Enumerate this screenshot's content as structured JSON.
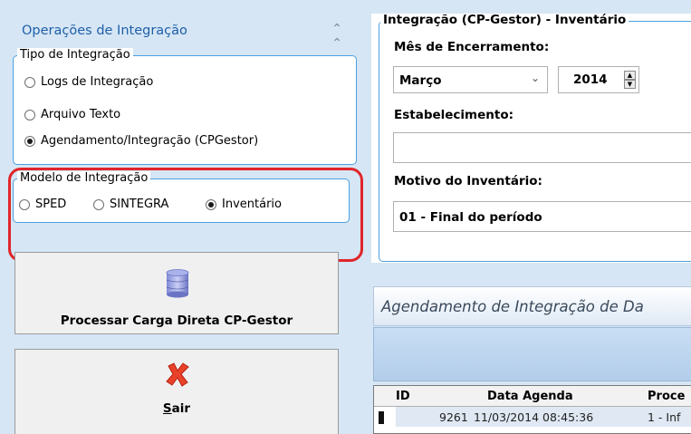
{
  "left": {
    "panel_title": "Operações de Integração",
    "tipo": {
      "legend": "Tipo de Integração",
      "options": [
        "Logs de Integração",
        "Arquivo Texto",
        "Agendamento/Integração (CPGestor)"
      ],
      "selected": "Agendamento/Integração (CPGestor)"
    },
    "modelo": {
      "legend": "Modelo de Integração",
      "options": [
        "SPED",
        "SINTEGRA",
        "Inventário"
      ],
      "selected": "Inventário"
    },
    "process_button": "Processar Carga Direta CP-Gestor",
    "exit_button": "Sair"
  },
  "right": {
    "group_title": "Integração (CP-Gestor) - Inventário",
    "mes_label": "Mês de Encerramento:",
    "month_value": "Março",
    "year_value": "2014",
    "estab_label": "Estabelecimento:",
    "estab_value": "",
    "motivo_label": "Motivo do Inventário:",
    "motivo_value": "01 - Final do período",
    "agenda_title": "Agendamento de Integração de Da",
    "grid": {
      "columns": [
        "ID",
        "Data Agenda",
        "Proce"
      ],
      "rows": [
        {
          "id": "9261",
          "data": "11/03/2014 08:45:36",
          "proc": "1 - Inf"
        }
      ]
    }
  },
  "colors": {
    "accent": "#1f5fa8",
    "highlight": "#e0252a",
    "border": "#4aa0e0"
  }
}
